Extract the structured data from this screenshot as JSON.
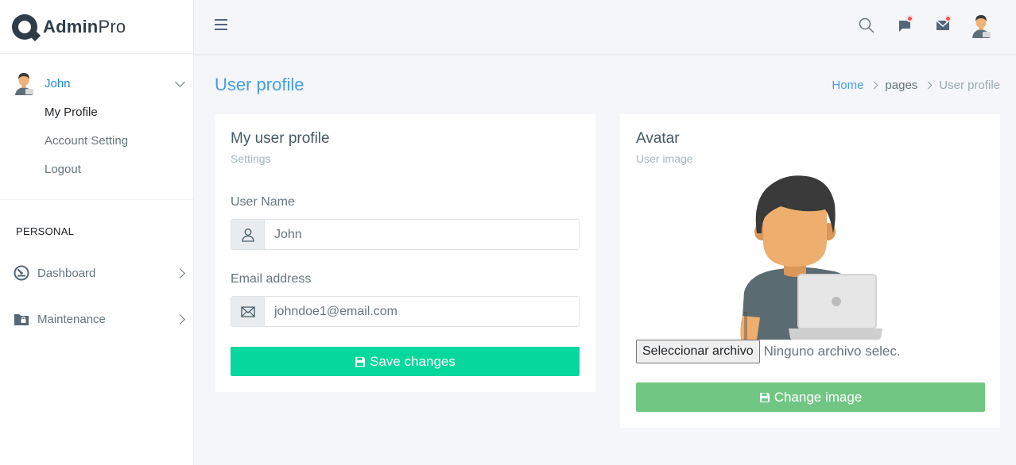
{
  "brand": {
    "name_bold": "Admin",
    "name_light": "Pro"
  },
  "sidebar": {
    "user": {
      "name": "John"
    },
    "user_menu": [
      "My Profile",
      "Account Setting",
      "Logout"
    ],
    "section_label": "PERSONAL",
    "nav": [
      {
        "label": "Dashboard",
        "icon": "gauge-icon"
      },
      {
        "label": "Maintenance",
        "icon": "folder-lock-icon"
      }
    ]
  },
  "topbar": {
    "icons": [
      "search-icon",
      "chat-icon",
      "mail-icon",
      "user-avatar"
    ]
  },
  "page": {
    "title": "User profile",
    "breadcrumb": [
      "Home",
      "pages",
      "User profile"
    ]
  },
  "profile_card": {
    "title": "My user profile",
    "subtitle": "Settings",
    "username_label": "User Name",
    "username_value": "John",
    "email_label": "Email address",
    "email_value": "johndoe1@email.com",
    "save_label": "Save changes"
  },
  "avatar_card": {
    "title": "Avatar",
    "subtitle": "User image",
    "file_button_label": "Seleccionar archivo",
    "file_status": "Ninguno archivo selec.",
    "change_label": "Change image"
  },
  "colors": {
    "accent": "#1e88e5",
    "save": "#06d79c",
    "change": "#71c683",
    "notification": "#ef5350"
  }
}
